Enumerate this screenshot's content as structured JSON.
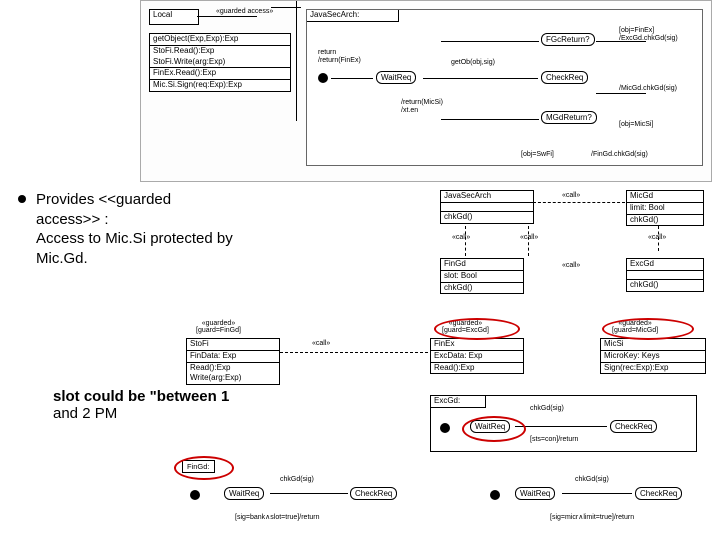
{
  "left": {
    "bullet": {
      "l1": "Provides <<guarded",
      "l2": "access>> :",
      "l3": "Access to Mic.Si protected by",
      "l4": "Mic.Gd."
    },
    "body": {
      "l1": "slot could be \"between 1",
      "l2": "and 2 PM"
    }
  },
  "top_diagram": {
    "local": "Local",
    "guarded_access": "«guarded access»",
    "ops_box": {
      "l1": "getObject(Exp,Exp):Exp",
      "l2": "StoFi.Read():Exp",
      "l3": "StoFi.Write(arg:Exp)",
      "l4": "FinEx.Read():Exp",
      "l5": "Mic.Si.Sign(req:Exp):Exp"
    },
    "jsa": "JavaSecArch:",
    "return1": "return",
    "return2": "/return(FinEx)",
    "return3": "/return(MicSi)",
    "return4": "/xt.en",
    "states": {
      "waitreq": "WaitReq",
      "fgc": "FGcReturn?",
      "getob": "getOb(obj,sig)",
      "checkreq": "CheckReq",
      "mgd": "MGdReturn?"
    },
    "guards": {
      "g1": "[obj=FinEx]",
      "g2": "/ExcGd.chkGd(sig)",
      "g3": "/MicGd.chkGd(sig)",
      "g4": "[obj=MicSi]",
      "g5": "[obj=SwFi]",
      "g6": "/FinGd.chkGd(sig)"
    }
  },
  "right_diagram": {
    "jsa": {
      "title": "JavaSecArch",
      "op": "chkGd()"
    },
    "micgd": {
      "title": "MicGd",
      "attr": "limit: Bool",
      "op": "chkGd()"
    },
    "calls": {
      "call": "«call»"
    },
    "fingd": {
      "title": "FinGd",
      "attr": "slot: Bool",
      "op": "chkGd()"
    },
    "excgd": {
      "title": "ExcGd",
      "op": "chkGd()"
    },
    "stofi": {
      "title": "StoFi",
      "attr": "FinData: Exp",
      "op1": "Read():Exp",
      "op2": "Write(arg:Exp)",
      "guarded": "«guarded»",
      "guard": "[guard=FinGd]"
    },
    "finex": {
      "title": "FinEx",
      "attr": "ExcData: Exp",
      "op": "Read():Exp",
      "guarded": "«guarded»",
      "guard": "[guard=ExcGd]"
    },
    "micsi": {
      "title": "MicSi",
      "attr": "MicroKey: Keys",
      "op": "Sign(rec:Exp):Exp",
      "guarded": "«guarded»",
      "guard": "[guard=MicGd]"
    },
    "excgd_state": {
      "title": "ExcGd:",
      "chk": "chkGd(sig)",
      "waitreq": "WaitReq",
      "checkreq": "CheckReq",
      "cond": "[sts=con]/return"
    },
    "fingd_state": {
      "title": "FinGd:",
      "waitreq": "WaitReq",
      "checkreq": "CheckReq",
      "chk": "chkGd(sig)",
      "cond": "[sig=bank∧slot=true]/return"
    },
    "micgd_state": {
      "waitreq": "WaitReq",
      "checkreq": "CheckReq",
      "chk": "chkGd(sig)",
      "cond": "[sig=micr∧limit=true]/return"
    }
  }
}
